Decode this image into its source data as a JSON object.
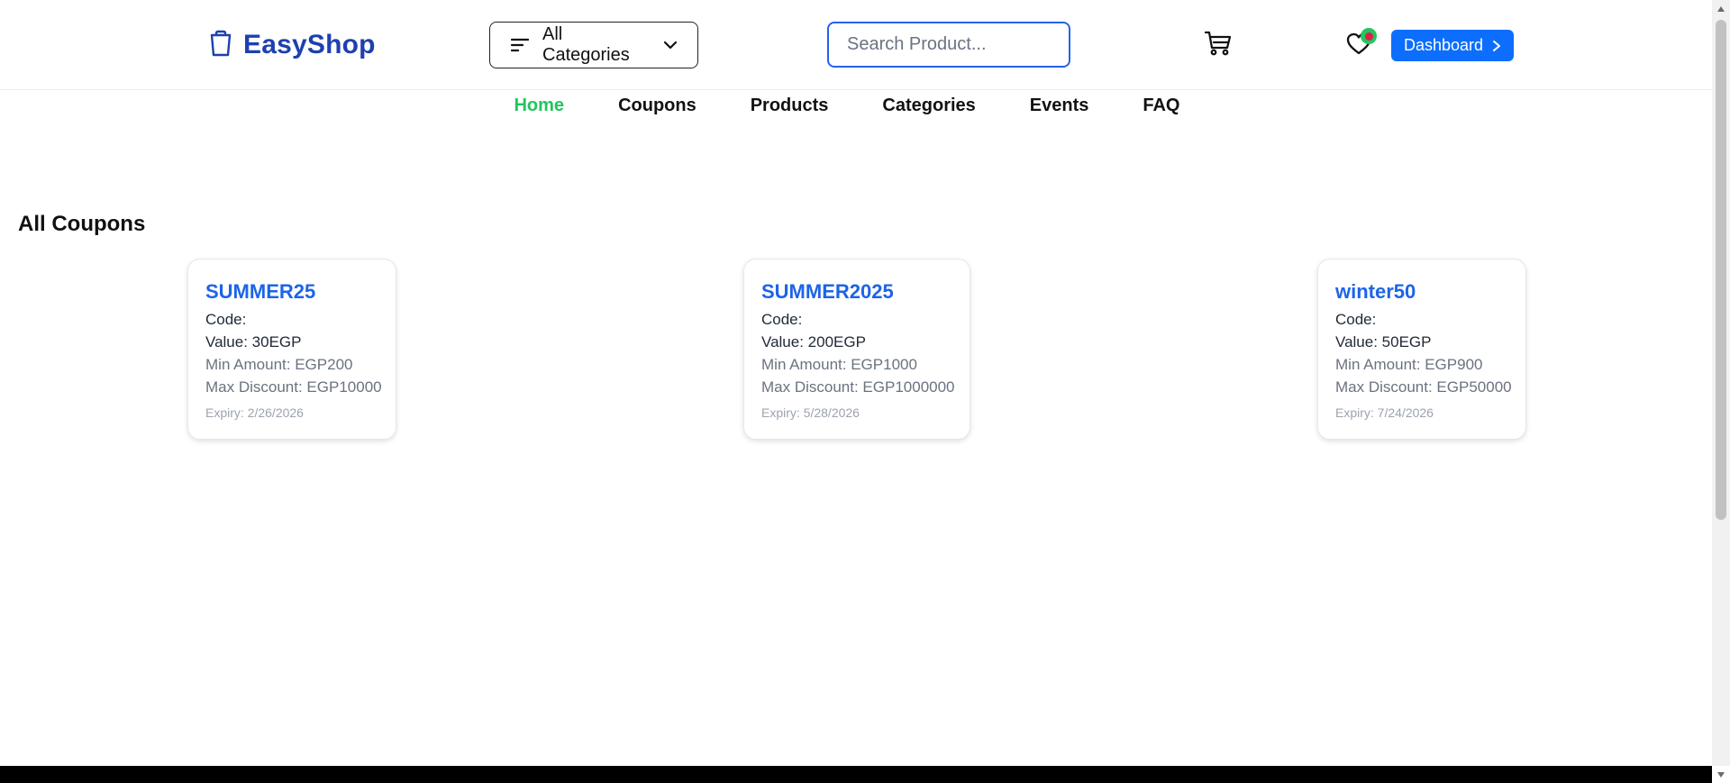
{
  "header": {
    "logo_text": "EasyShop",
    "categories_label": "All Categories",
    "search_placeholder": "Search Product...",
    "dashboard_label": "Dashboard",
    "colors": {
      "brand": "#1e40af",
      "primary": "#0d6efd",
      "badge": "#22c55e"
    }
  },
  "nav": {
    "items": [
      "Home",
      "Coupons",
      "Products",
      "Categories",
      "Events",
      "FAQ"
    ],
    "active": "Home",
    "active_color": "#22c55e"
  },
  "coupons_section": {
    "title": "All Coupons",
    "coupons": [
      {
        "name": "SUMMER25",
        "code": "Code:",
        "value": "Value: 30EGP",
        "min_amount": "Min Amount: EGP200",
        "max_discount": "Max Discount: EGP10000",
        "expiry": "Expiry: 2/26/2026"
      },
      {
        "name": "SUMMER2025",
        "code": "Code:",
        "value": "Value: 200EGP",
        "min_amount": "Min Amount: EGP1000",
        "max_discount": "Max Discount: EGP1000000",
        "expiry": "Expiry: 5/28/2026"
      },
      {
        "name": "winter50",
        "code": "Code:",
        "value": "Value: 50EGP",
        "min_amount": "Min Amount: EGP900",
        "max_discount": "Max Discount: EGP50000",
        "expiry": "Expiry: 7/24/2026"
      }
    ]
  },
  "icons": {
    "logo": "shopping-bag-icon",
    "categories": "filter-lines-icon",
    "dropdown": "chevron-down-icon",
    "cart": "cart-icon",
    "wishlist": "heart-icon",
    "dashboard": "chevron-right-icon"
  }
}
